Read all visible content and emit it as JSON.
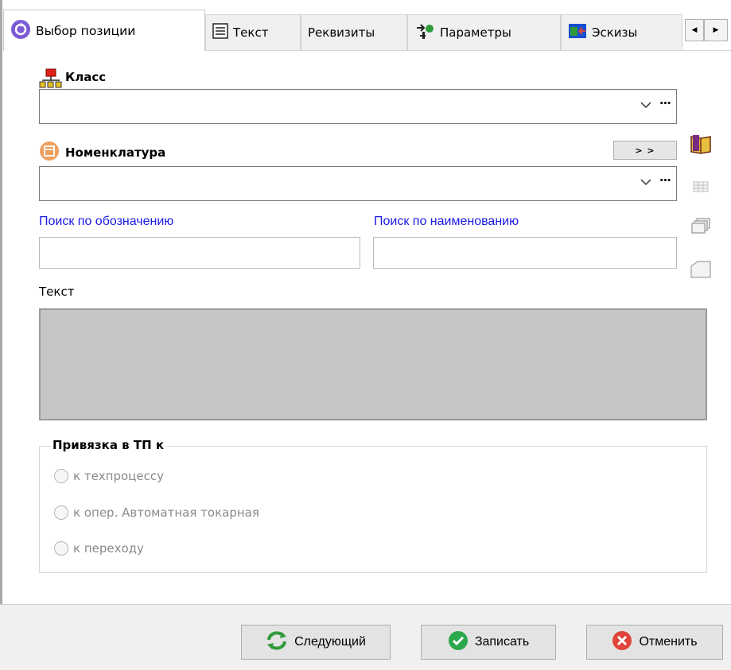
{
  "tabs": [
    {
      "label": "Выбор позиции",
      "icon": "circle-arrows-icon",
      "active": true
    },
    {
      "label": "Текст",
      "icon": "text-document-icon",
      "active": false
    },
    {
      "label": "Реквизиты",
      "icon": "",
      "active": false
    },
    {
      "label": "Параметры",
      "icon": "parameters-icon",
      "active": false
    },
    {
      "label": "Эскизы",
      "icon": "sketch-icon",
      "active": false
    }
  ],
  "class_field": {
    "label": "Класс",
    "value": "",
    "more": "···"
  },
  "nomenclature_field": {
    "label": "Номенклатура",
    "value": "",
    "more": "···",
    "expand_button": "> >"
  },
  "search": {
    "by_designation_label": "Поиск по обозначению",
    "by_designation_value": "",
    "by_name_label": "Поиск по наименованию",
    "by_name_value": ""
  },
  "text_section": {
    "label": "Текст",
    "value": ""
  },
  "binding": {
    "title": "Привязка в ТП к",
    "options": [
      {
        "label": "к техпроцессу",
        "checked": false
      },
      {
        "label": "к опер. Автоматная токарная",
        "checked": false
      },
      {
        "label": "к переходу",
        "checked": false
      }
    ]
  },
  "buttons": {
    "next": "Следующий",
    "save": "Записать",
    "cancel": "Отменить"
  },
  "colors": {
    "link_blue": "#1a1ae6",
    "save_green": "#2aa84a",
    "cancel_red": "#e0443a",
    "next_green": "#2e9a3a"
  }
}
